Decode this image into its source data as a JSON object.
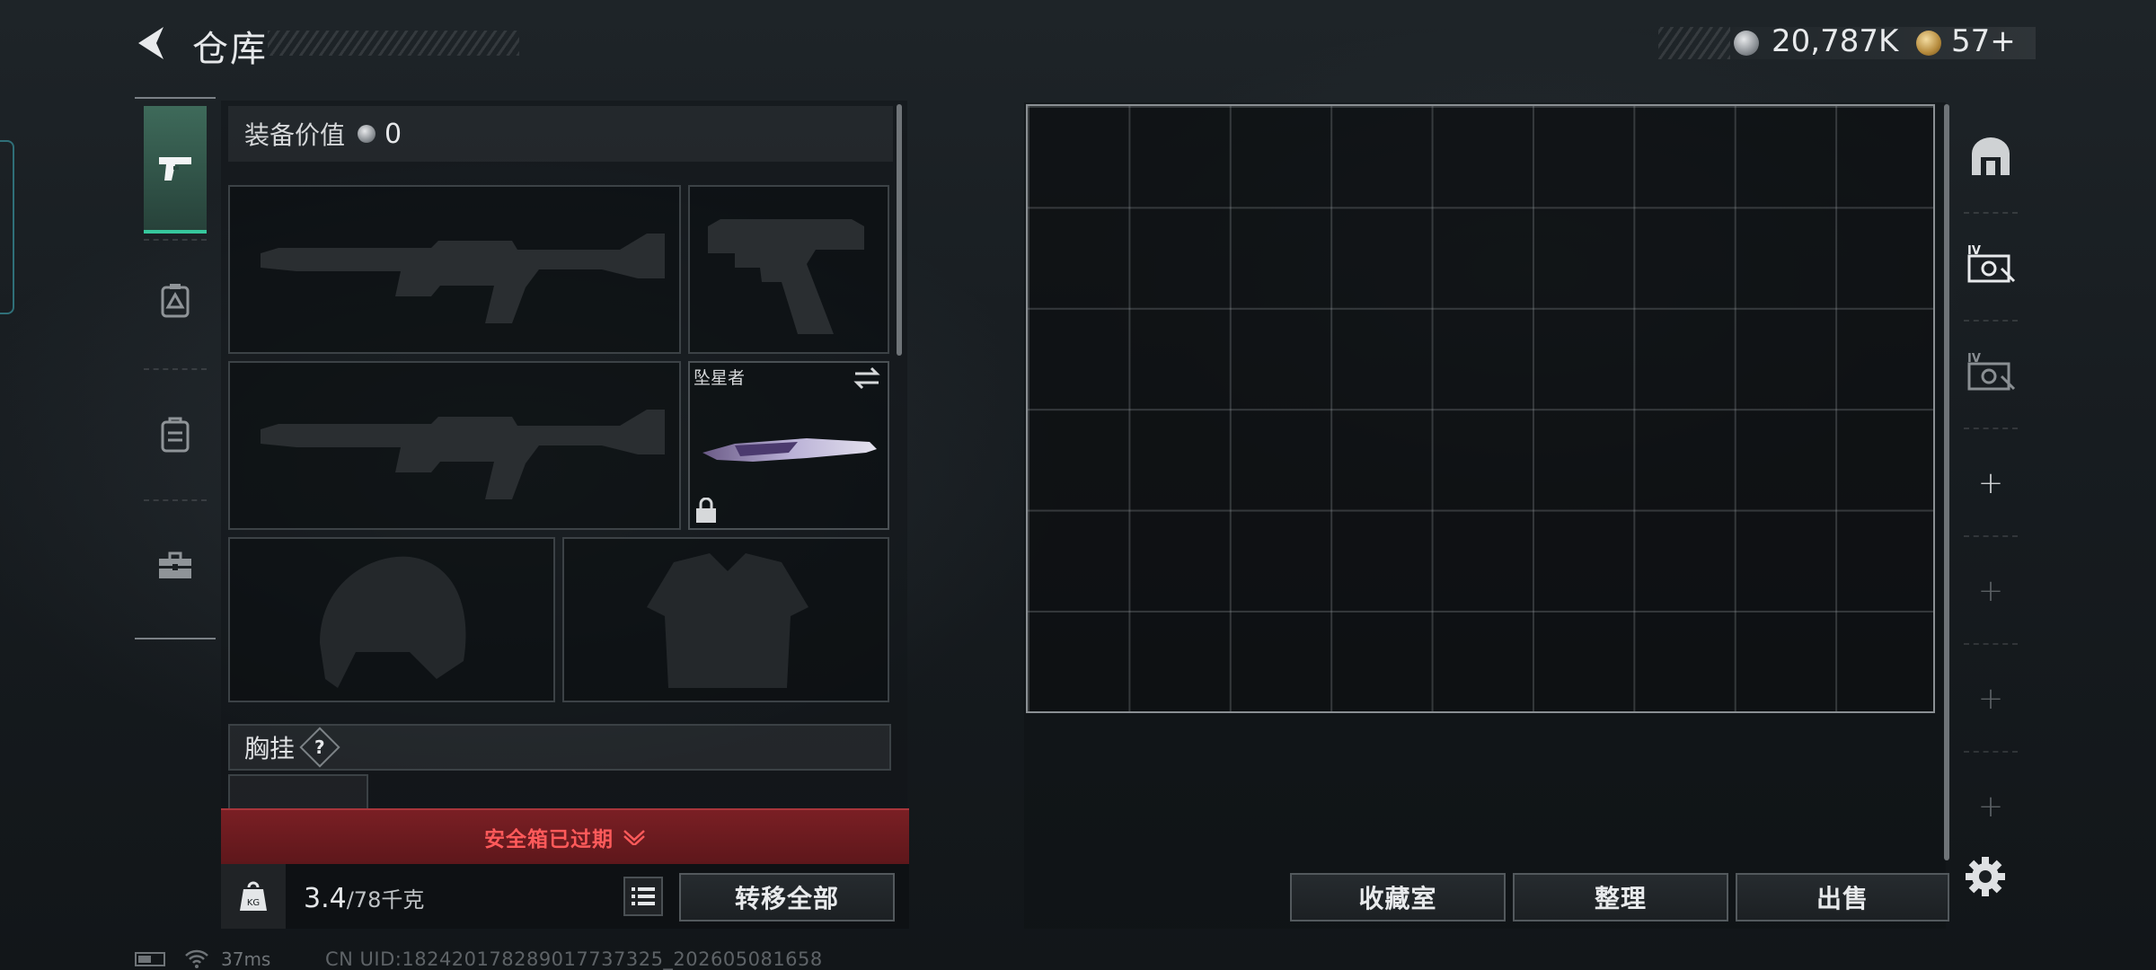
{
  "header": {
    "title": "仓库",
    "currency_silver": "20,787K",
    "currency_gold": "57+"
  },
  "loadout": {
    "value_label": "装备价值",
    "value_amount": "0",
    "melee_name": "坠星者",
    "chest_rig_label": "胸挂",
    "chest_rig_help": "?",
    "expired_text": "安全箱已过期",
    "weight_current": "3.4",
    "weight_capacity": "/78千克",
    "transfer_all_label": "转移全部"
  },
  "stash": {
    "columns": 9,
    "rows": 6,
    "collection_label": "收藏室",
    "organize_label": "整理",
    "sell_label": "出售"
  },
  "right_rail": {
    "plus": "+"
  },
  "status": {
    "ping": "37ms",
    "uid": "CN UID:182420178289017737325_202605081658"
  },
  "colors": {
    "accent_green": "#36c79c",
    "expired_red": "#ff5a5a",
    "expired_bg": "#6a1a1f"
  }
}
